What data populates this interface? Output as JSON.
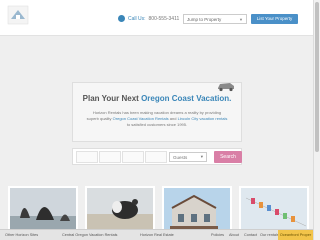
{
  "header": {
    "call_label": "Call Us:",
    "phone": "800-555-3411",
    "jump_placeholder": "Jump to Property",
    "list_button": "List Your Property"
  },
  "hero": {
    "title_prefix": "Plan Your Next",
    "title_highlight": "Oregon Coast Vacation.",
    "desc_1": "Horizon Rentals has been making vacation dreams a reality by providing",
    "desc_2": "superb quality",
    "link_1": "Oregon Coast Vacation Rentals",
    "desc_3": "and",
    "link_2": "Lincoln City vacation rentals",
    "desc_4": "to satisfied customers since 1995."
  },
  "search": {
    "guests_label": "Guests",
    "button": "Search"
  },
  "footer_nav": {
    "item_1": "Other Horizon Sites",
    "item_2": "Central Oregon Vacation Rentals",
    "item_3": "Horizon Real Estate",
    "item_4": "Policies",
    "item_5": "About",
    "item_6": "Contact",
    "item_7": "Our rentals",
    "item_8": "Oceanfront Proper"
  },
  "colors": {
    "brand_blue": "#3a86b8",
    "search_pink": "#d97fa6",
    "active_tab": "#f2c44a"
  }
}
